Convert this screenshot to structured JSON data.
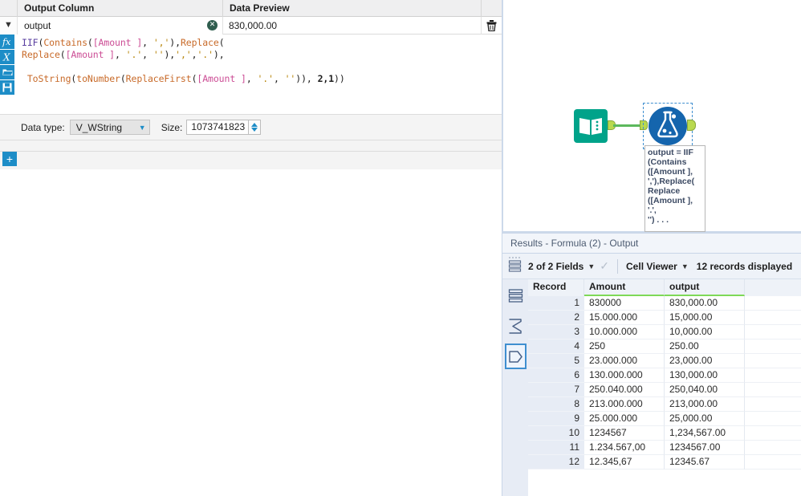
{
  "config": {
    "headers": {
      "output_column": "Output Column",
      "data_preview": "Data Preview"
    },
    "output_name": "output",
    "output_placeholder": "Output Column",
    "data_preview_value": "830,000.00",
    "clear_icon": "clear-x-icon",
    "delete_icon": "trash-icon",
    "dropdown_icon": "chevron-down-icon",
    "rail_icons": [
      "fx-icon",
      "variable-x-icon",
      "folder-open-icon",
      "save-disk-icon"
    ],
    "add_button_label": "+",
    "formula_lines": [
      [
        {
          "t": "IIF",
          "c": "kw"
        },
        {
          "t": "(",
          "c": "op"
        },
        {
          "t": "Contains",
          "c": "fn"
        },
        {
          "t": "(",
          "c": "op"
        },
        {
          "t": "[Amount ]",
          "c": "field"
        },
        {
          "t": ", ",
          "c": "op"
        },
        {
          "t": "','",
          "c": "str"
        },
        {
          "t": "),",
          "c": "op"
        },
        {
          "t": "Replace",
          "c": "fn"
        },
        {
          "t": "(",
          "c": "op"
        }
      ],
      [
        {
          "t": "Replace",
          "c": "fn"
        },
        {
          "t": "(",
          "c": "op"
        },
        {
          "t": "[Amount ]",
          "c": "field"
        },
        {
          "t": ", ",
          "c": "op"
        },
        {
          "t": "'.'",
          "c": "str"
        },
        {
          "t": ", ",
          "c": "op"
        },
        {
          "t": "''",
          "c": "str"
        },
        {
          "t": "),",
          "c": "op"
        },
        {
          "t": "','",
          "c": "str"
        },
        {
          "t": ",",
          "c": "op"
        },
        {
          "t": "'.'",
          "c": "str"
        },
        {
          "t": "),",
          "c": "op"
        }
      ],
      [
        {
          "t": " ToString",
          "c": "fn"
        },
        {
          "t": "(",
          "c": "op"
        },
        {
          "t": "toNumber",
          "c": "fn"
        },
        {
          "t": "(",
          "c": "op"
        },
        {
          "t": "ReplaceFirst",
          "c": "fn"
        },
        {
          "t": "(",
          "c": "op"
        },
        {
          "t": "[Amount ]",
          "c": "field"
        },
        {
          "t": ", ",
          "c": "op"
        },
        {
          "t": "'.'",
          "c": "str"
        },
        {
          "t": ", ",
          "c": "op"
        },
        {
          "t": "''",
          "c": "str"
        },
        {
          "t": ")), ",
          "c": "op"
        },
        {
          "t": "2,1",
          "c": "num"
        },
        {
          "t": "))",
          "c": "op"
        }
      ]
    ],
    "data_type_label": "Data type:",
    "data_type_value": "V_WString",
    "size_label": "Size:",
    "size_value": "1073741823"
  },
  "canvas": {
    "input_node_icon": "text-input-book-icon",
    "formula_node_icon": "formula-flask-icon",
    "annotation_lines": [
      "output = IIF",
      "(Contains",
      "([Amount ],",
      "','),Replace(",
      "Replace",
      "([Amount ], '.',",
      "'') . . ."
    ]
  },
  "results": {
    "title": "Results - Formula (2) - Output",
    "toolbar": {
      "fields_label": "2 of 2 Fields",
      "view_mode": "Cell Viewer",
      "records_label": "12 records displayed",
      "grip_icon": "drag-grip-icon",
      "rows-icon": "table-rows-icon",
      "check_icon": "checkmark-icon"
    },
    "rail_icons": [
      "table-rows-icon",
      "summary-sigma-icon",
      "output-shape-icon"
    ],
    "columns": [
      "Record",
      "Amount",
      "output"
    ],
    "rows": [
      {
        "record": "1",
        "amount": "830000",
        "output": "830,000.00"
      },
      {
        "record": "2",
        "amount": "15.000.000",
        "output": "15,000.00"
      },
      {
        "record": "3",
        "amount": "10.000.000",
        "output": "10,000.00"
      },
      {
        "record": "4",
        "amount": "250",
        "output": "250.00"
      },
      {
        "record": "5",
        "amount": "23.000.000",
        "output": "23,000.00"
      },
      {
        "record": "6",
        "amount": "130.000.000",
        "output": "130,000.00"
      },
      {
        "record": "7",
        "amount": "250.040.000",
        "output": "250,040.00"
      },
      {
        "record": "8",
        "amount": "213.000.000",
        "output": "213,000.00"
      },
      {
        "record": "9",
        "amount": "25.000.000",
        "output": "25,000.00"
      },
      {
        "record": "10",
        "amount": "1234567",
        "output": "1,234,567.00"
      },
      {
        "record": "11",
        "amount": "1.234.567,00",
        "output": "1234567.00"
      },
      {
        "record": "12",
        "amount": "12.345,67",
        "output": "12345.67"
      }
    ]
  },
  "colors": {
    "accent_blue": "#1d8dc7",
    "node_green": "#00a38a",
    "node_blue": "#1565ad",
    "port_green": "#b9d94f",
    "connector_green": "#5cb85c",
    "header_green_underline": "#7ed957"
  }
}
